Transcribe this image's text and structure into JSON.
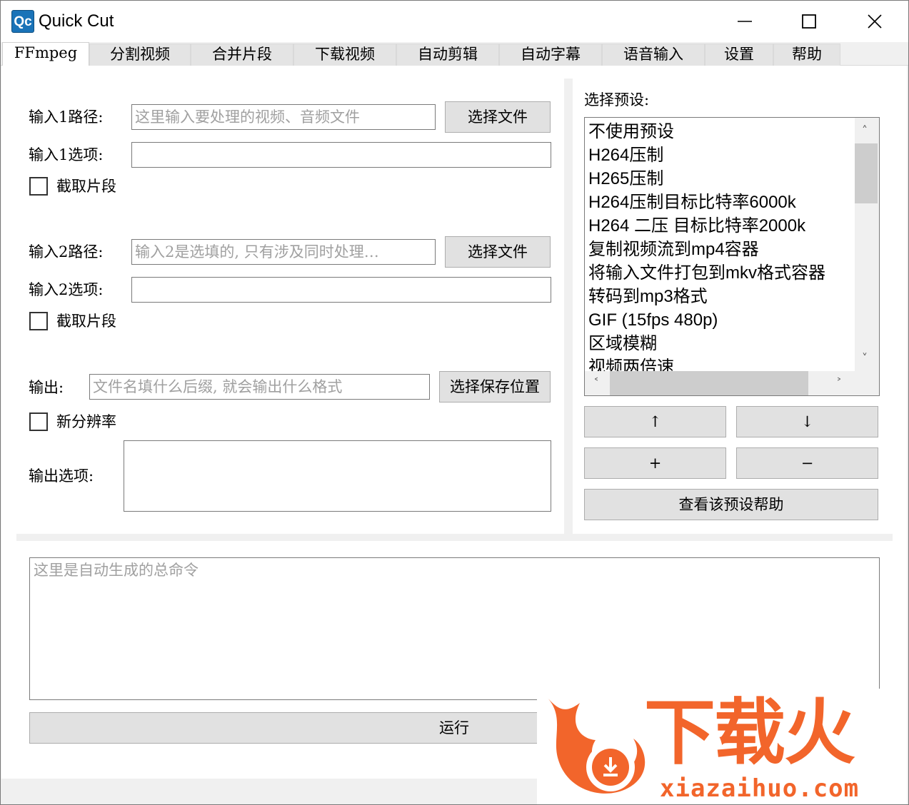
{
  "window": {
    "logo_text": "Qc",
    "title": "Quick Cut"
  },
  "tabs": [
    {
      "label": "FFmpeg",
      "active": true
    },
    {
      "label": "分割视频"
    },
    {
      "label": "合并片段"
    },
    {
      "label": "下载视频"
    },
    {
      "label": "自动剪辑"
    },
    {
      "label": "自动字幕"
    },
    {
      "label": "语音输入"
    },
    {
      "label": "设置"
    },
    {
      "label": "帮助"
    }
  ],
  "input1": {
    "path_label": "输入1路径:",
    "path_placeholder": "这里输入要处理的视频、音频文件",
    "browse_label": "选择文件",
    "options_label": "输入1选项:",
    "options_value": "",
    "clip_label": "截取片段"
  },
  "input2": {
    "path_label": "输入2路径:",
    "path_placeholder": "输入2是选填的, 只有涉及同时处理…",
    "browse_label": "选择文件",
    "options_label": "输入2选项:",
    "options_value": "",
    "clip_label": "截取片段"
  },
  "output": {
    "label": "输出:",
    "placeholder": "文件名填什么后缀, 就会输出什么格式",
    "save_label": "选择保存位置",
    "resolution_label": "新分辨率",
    "options_label": "输出选项:",
    "options_value": ""
  },
  "presets": {
    "label": "选择预设:",
    "items": [
      "不使用预设",
      "H264压制",
      "H265压制",
      "H264压制目标比特率6000k",
      "H264 二压 目标比特率2000k",
      "复制视频流到mp4容器",
      "将输入文件打包到mkv格式容器",
      "转码到mp3格式",
      "GIF (15fps 480p)",
      "区域模糊",
      "视频两倍速"
    ],
    "up_label": "↑",
    "down_label": "↓",
    "add_label": "+",
    "remove_label": "−",
    "help_label": "查看该预设帮助"
  },
  "command": {
    "placeholder": "这里是自动生成的总命令"
  },
  "run_label": "运行",
  "watermark": {
    "text": "下载火",
    "url": "xiazaihuo.com"
  },
  "colors": {
    "watermark": "#f2652b",
    "logo": "#1a73b8"
  }
}
